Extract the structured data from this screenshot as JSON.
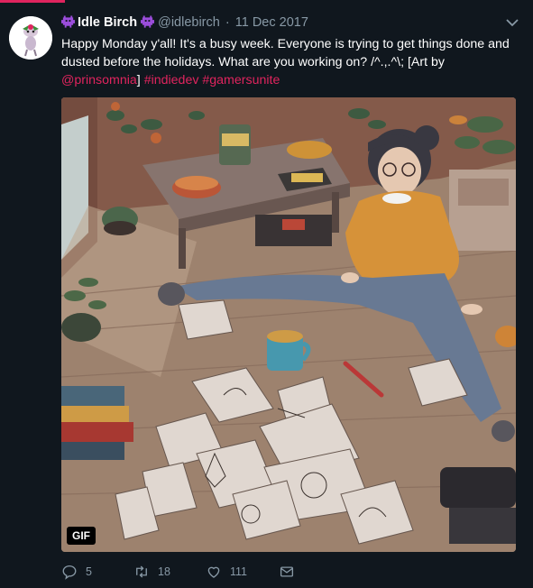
{
  "tweet": {
    "display_name": "Idle Birch",
    "handle": "@idlebirch",
    "separator": "·",
    "date": "11 Dec 2017",
    "text_main": "Happy Monday y'all! It's a busy week. Everyone is trying to get things done and dusted before the holidays. What are you working on? /^.,.^\\; [Art by ",
    "mention": "@prinsomnia",
    "text_close": "] ",
    "hashtag_1": "#indiedev",
    "space": " ",
    "hashtag_2": "#gamersunite",
    "media_badge": "GIF"
  },
  "actions": {
    "replies": "5",
    "retweets": "18",
    "likes": "111"
  },
  "icons": {
    "name_left": "alien-monster-emoji-icon",
    "name_right": "alien-monster-emoji-icon",
    "menu": "chevron-down-icon",
    "reply": "reply-icon",
    "retweet": "retweet-icon",
    "like": "heart-icon",
    "dm": "envelope-icon"
  },
  "colors": {
    "background": "#10171e",
    "link": "#e0245e",
    "muted": "#8899a6",
    "emoji": "#9b4ddb"
  }
}
